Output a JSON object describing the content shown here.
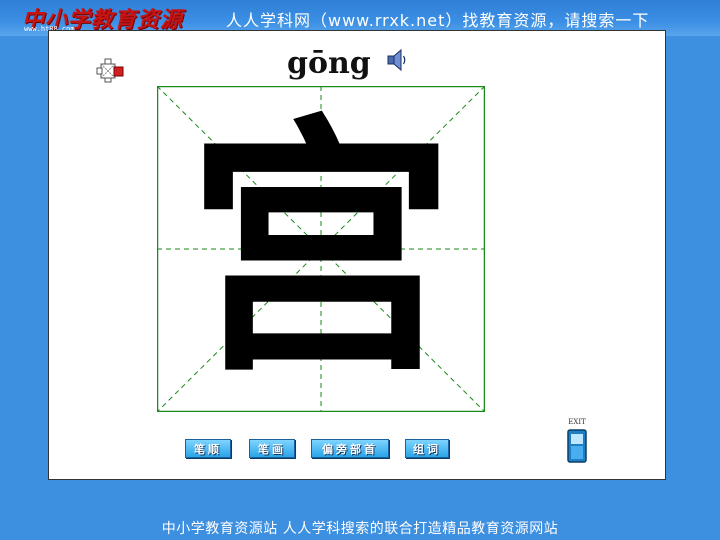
{
  "header": {
    "logo": "中小学教育资源",
    "logo_url": "www.ht88.com",
    "banner": "人人学科网（www.rrxk.net）找教育资源，请搜索一下"
  },
  "lesson": {
    "pinyin": "gōng",
    "character": "宫"
  },
  "buttons": [
    {
      "label": "笔顺"
    },
    {
      "label": "笔画"
    },
    {
      "label": "偏旁部首"
    },
    {
      "label": "组词"
    }
  ],
  "exit_label": "EXIT",
  "footer": {
    "text": "中小学教育资源站 人人学科搜索的联合打造精品教育资源网站"
  },
  "colors": {
    "banner_blue": "#3d8fe0",
    "grid_green": "#1a8a1a",
    "button_blue": "#2aa4e8"
  }
}
